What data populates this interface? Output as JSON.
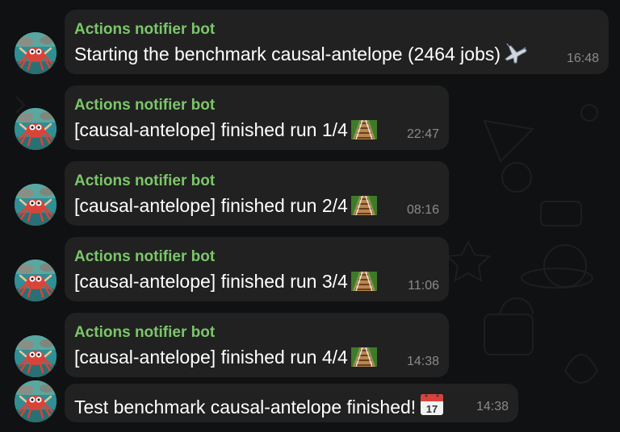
{
  "chat": {
    "messages": [
      {
        "sender": "Actions notifier bot",
        "text": "Starting the benchmark causal-antelope (2464 jobs)",
        "emoji": "airplane-icon",
        "time": "16:48"
      },
      {
        "sender": "Actions notifier bot",
        "text": "[causal-antelope] finished run 1/4",
        "emoji": "railway-track-icon",
        "time": "22:47"
      },
      {
        "sender": "Actions notifier bot",
        "text": "[causal-antelope] finished run 2/4",
        "emoji": "railway-track-icon",
        "time": "08:16"
      },
      {
        "sender": "Actions notifier bot",
        "text": "[causal-antelope] finished run 3/4",
        "emoji": "railway-track-icon",
        "time": "11:06"
      },
      {
        "sender": "Actions notifier bot",
        "text": "[causal-antelope] finished run 4/4",
        "emoji": "railway-track-icon",
        "time": "14:38"
      },
      {
        "text": "Test benchmark causal-antelope finished!",
        "emoji": "calendar-icon",
        "time": "14:38"
      }
    ]
  },
  "theme": {
    "background": "#101112",
    "bubble": "#212121",
    "sender_color": "#7cc66a",
    "text_color": "#ffffff",
    "time_color": "#8a8a8a"
  }
}
